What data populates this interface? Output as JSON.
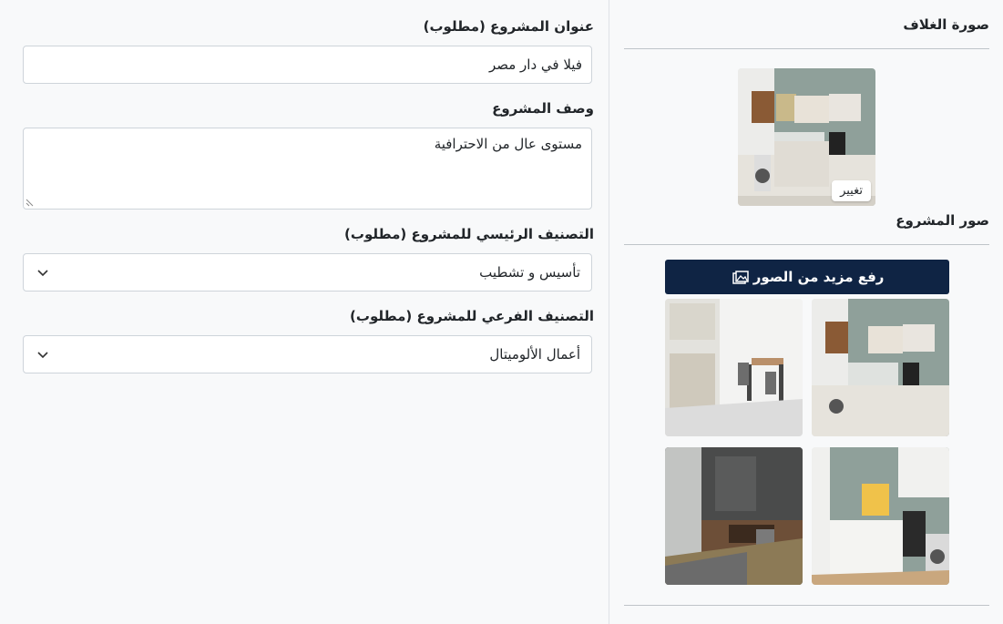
{
  "form": {
    "title_label": "عنوان المشروع (مطلوب)",
    "title_value": "فيلا في دار مصر",
    "description_label": "وصف المشروع",
    "description_value": "مستوى عال من الاحترافية",
    "main_category_label": "التصنيف الرئيسي للمشروع (مطلوب)",
    "main_category_value": "تأسيس و تشطيب",
    "sub_category_label": "التصنيف الفرعي للمشروع (مطلوب)",
    "sub_category_value": "أعمال الألوميتال"
  },
  "cover": {
    "title": "صورة الغلاف",
    "change_label": "تغيير"
  },
  "gallery": {
    "title": "صور المشروع",
    "upload_label": "رفع مزيد من الصور",
    "upload_icon": "images-icon"
  },
  "colors": {
    "primary": "#0f2444",
    "border": "#ced4da",
    "background": "#f8f9fa"
  }
}
